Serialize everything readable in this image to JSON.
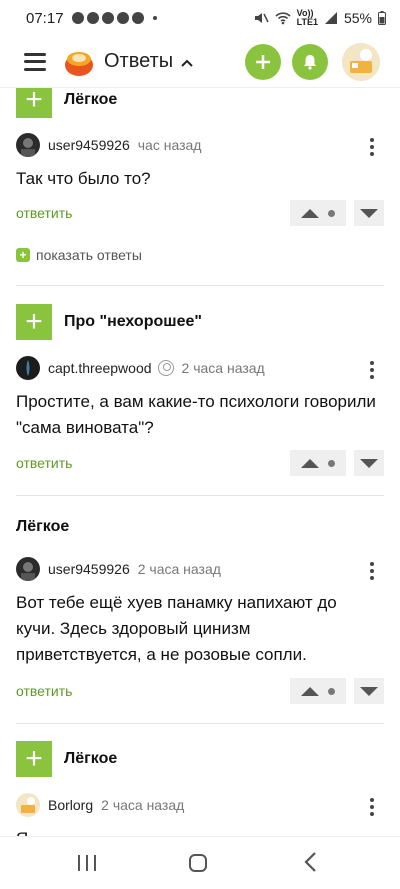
{
  "status": {
    "time": "07:17",
    "battery": "55%",
    "net_top": "Vo))",
    "net_bottom": "LTE1"
  },
  "appbar": {
    "title": "Ответы",
    "accent": "#8ac43f"
  },
  "topics": {
    "t1": "Лёгкое",
    "t2": "Про \"нехорошее\"",
    "t3": "Лёгкое",
    "t4": "Лёгкое"
  },
  "comments": [
    {
      "user": "user9459926",
      "time": "час назад",
      "text": "Так что было то?"
    },
    {
      "user": "capt.threepwood",
      "time": "2 часа назад",
      "text": "Простите, а вам какие-то психологи говорили \"сама виновата\"?"
    },
    {
      "user": "user9459926",
      "time": "2 часа назад",
      "text": "Вот тебе ещё хуев панамку напихают до кучи. Здесь здоровый цинизм приветствуется, а не розовые сопли."
    },
    {
      "user": "Borlorg",
      "time": "2 часа назад",
      "text": "Я"
    }
  ],
  "labels": {
    "reply": "ответить",
    "show_replies": "показать ответы"
  },
  "icons": {
    "menu": "hamburger-icon",
    "logo": "logo-icon",
    "add": "plus-icon",
    "notifications": "bell-icon",
    "more": "kebab-icon",
    "upvote": "arrow-up-icon",
    "downvote": "arrow-down-icon"
  }
}
